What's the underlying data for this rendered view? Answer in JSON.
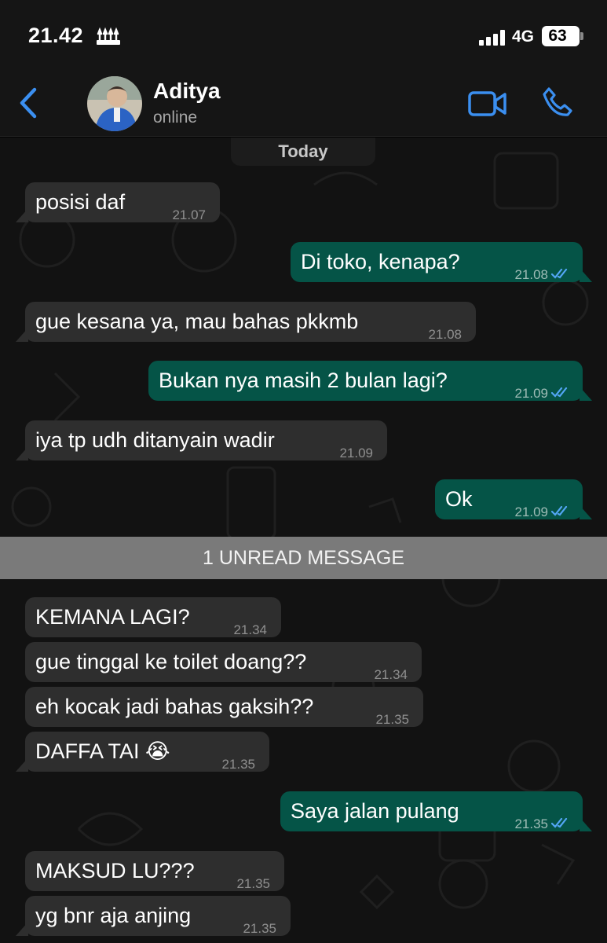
{
  "status_bar": {
    "time": "21.42",
    "network": "4G",
    "battery": "63"
  },
  "header": {
    "contact_name": "Aditya",
    "contact_status": "online"
  },
  "chat": {
    "date_label": "Today",
    "unread_label": "1 UNREAD MESSAGE",
    "messages": [
      {
        "dir": "in",
        "text": "posisi daf",
        "time": "21.07"
      },
      {
        "dir": "out",
        "text": "Di toko, kenapa?",
        "time": "21.08"
      },
      {
        "dir": "in",
        "text": "gue kesana ya, mau bahas pkkmb",
        "time": "21.08"
      },
      {
        "dir": "out",
        "text": "Bukan nya masih 2 bulan lagi?",
        "time": "21.09"
      },
      {
        "dir": "in",
        "text": "iya tp udh ditanyain wadir",
        "time": "21.09"
      },
      {
        "dir": "out",
        "text": "Ok",
        "time": "21.09"
      },
      {
        "dir": "in",
        "text": "KEMANA LAGI?",
        "time": "21.34"
      },
      {
        "dir": "in",
        "text": "gue tinggal ke toilet doang??",
        "time": "21.34"
      },
      {
        "dir": "in",
        "text": "eh kocak jadi bahas gaksih??",
        "time": "21.35"
      },
      {
        "dir": "in",
        "text": "DAFFA TAI 😭",
        "time": "21.35"
      },
      {
        "dir": "out",
        "text": "Saya jalan pulang",
        "time": "21.35"
      },
      {
        "dir": "in",
        "text": "MAKSUD LU???",
        "time": "21.35"
      },
      {
        "dir": "in",
        "text": "yg bnr aja anjing",
        "time": "21.35"
      }
    ]
  },
  "icons": {
    "back": "chevron-left-icon",
    "video": "video-camera-icon",
    "call": "phone-icon",
    "read_receipt": "double-check-icon"
  },
  "colors": {
    "accent": "#3b8ff0",
    "outgoing_bubble": "#055447",
    "incoming_bubble": "#2e2e2e",
    "unread_bar": "#7a7a7a",
    "read_ticks": "#53a6f5"
  }
}
